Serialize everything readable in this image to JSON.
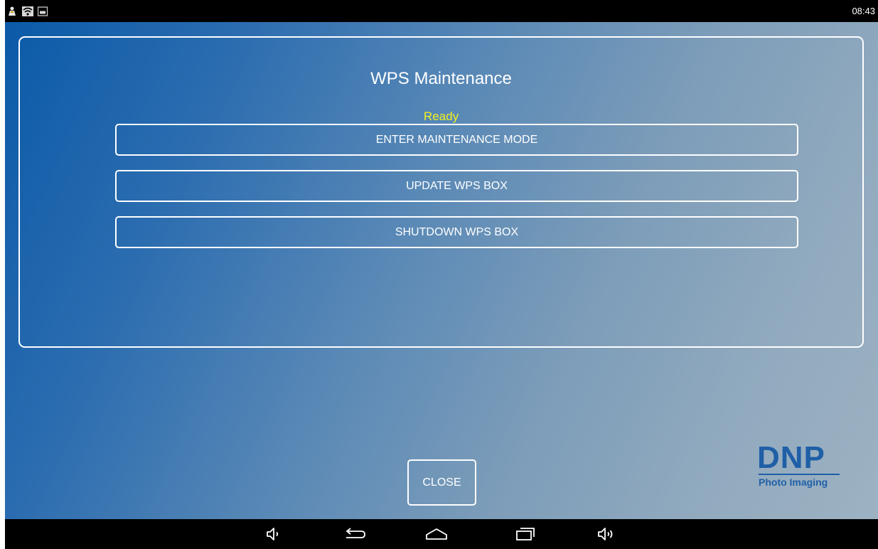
{
  "status_bar": {
    "time": "08:43",
    "icons": [
      "notification-person-icon",
      "wifi-icon",
      "image-notification-icon"
    ]
  },
  "dialog": {
    "title": "WPS Maintenance",
    "status": "Ready",
    "status_color": "#f2f020",
    "buttons": [
      {
        "label": "ENTER MAINTENANCE MODE"
      },
      {
        "label": "UPDATE WPS BOX"
      },
      {
        "label": "SHUTDOWN WPS BOX"
      }
    ]
  },
  "close_button": {
    "label": "CLOSE"
  },
  "logo": {
    "brand": "DNP",
    "subtitle": "Photo Imaging",
    "color": "#1f5fa6"
  },
  "nav_bar": {
    "buttons": [
      "volume-down-icon",
      "back-icon",
      "home-icon",
      "recent-apps-icon",
      "volume-up-icon"
    ]
  },
  "colors": {
    "gradient_start": "#0b5aa8",
    "gradient_end": "#9db2c2",
    "border": "#ffffff"
  }
}
